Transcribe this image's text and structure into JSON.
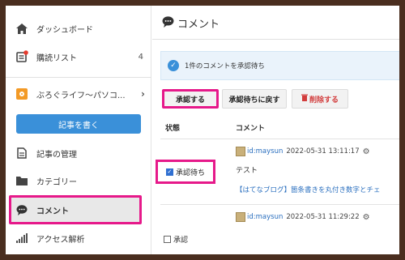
{
  "sidebar": {
    "items": [
      {
        "label": "ダッシュボード",
        "icon": "home-icon"
      },
      {
        "label": "購読リスト",
        "icon": "subscribe-icon",
        "count": "4"
      },
      {
        "label": "ぶろぐライフ〜パソコ...",
        "icon": "blog-icon",
        "chevron": "›"
      },
      {
        "label": "記事の管理",
        "icon": "document-icon"
      },
      {
        "label": "カテゴリー",
        "icon": "folder-icon"
      },
      {
        "label": "コメント",
        "icon": "comment-icon"
      },
      {
        "label": "アクセス解析",
        "icon": "bar-chart-icon"
      }
    ],
    "write_button": "記事を書く",
    "accent_color": "#3a90d9"
  },
  "main": {
    "title": "コメント",
    "alert": "1件のコメントを承認待ち",
    "buttons": {
      "approve": "承認する",
      "pending": "承認待ちに戻す",
      "delete": "削除する"
    },
    "table": {
      "headers": [
        "状態",
        "コメント"
      ],
      "rows": [
        {
          "status": "承認待ち",
          "checked": true,
          "author": "id:maysun",
          "timestamp": "2022-05-31 13:11:17",
          "text": "テスト",
          "link": "【はてなブログ】箇条書きを丸付き数字とチェ"
        },
        {
          "status": "承認",
          "checked": false,
          "author": "id:maysun",
          "timestamp": "2022-05-31 11:29:22"
        }
      ]
    }
  },
  "highlight_color": "#e6198a"
}
